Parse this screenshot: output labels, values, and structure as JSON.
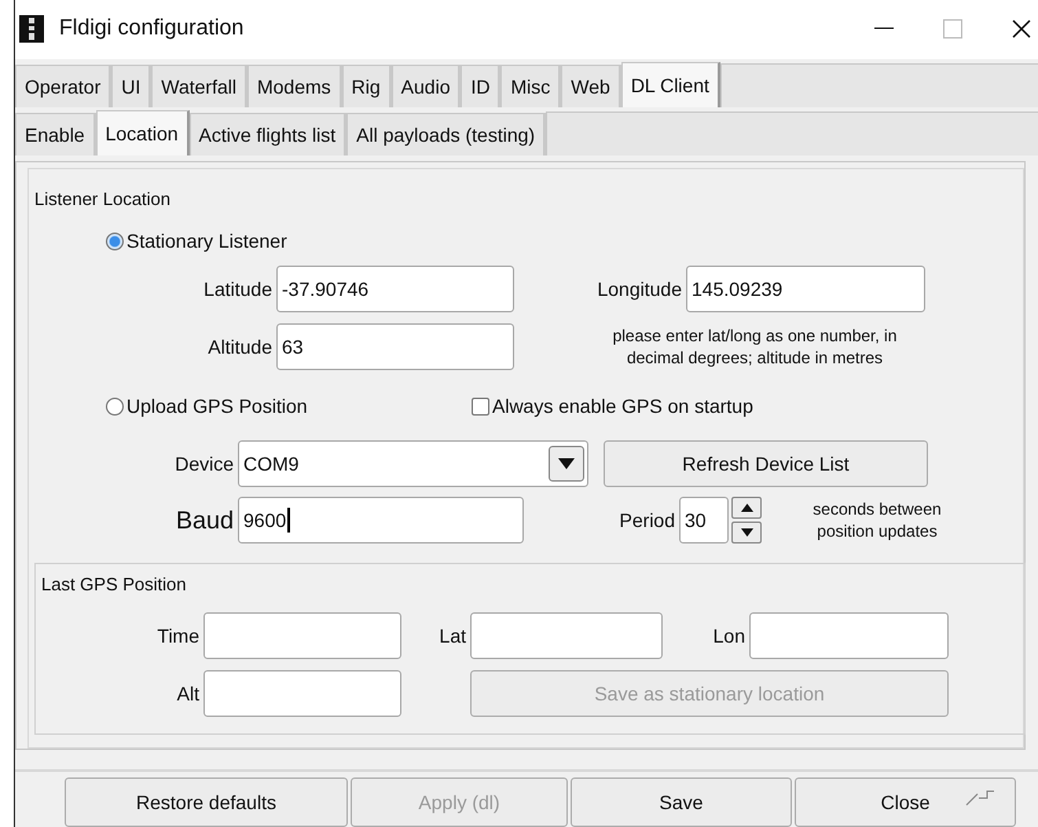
{
  "window": {
    "title": "Fldigi configuration"
  },
  "tabs": [
    {
      "label": "Operator",
      "selected": false
    },
    {
      "label": "UI",
      "selected": false
    },
    {
      "label": "Waterfall",
      "selected": false
    },
    {
      "label": "Modems",
      "selected": false
    },
    {
      "label": "Rig",
      "selected": false
    },
    {
      "label": "Audio",
      "selected": false
    },
    {
      "label": "ID",
      "selected": false
    },
    {
      "label": "Misc",
      "selected": false
    },
    {
      "label": "Web",
      "selected": false
    },
    {
      "label": "DL Client",
      "selected": true
    }
  ],
  "subtabs": [
    {
      "label": "Enable",
      "selected": false
    },
    {
      "label": "Location",
      "selected": true
    },
    {
      "label": "Active flights list",
      "selected": false
    },
    {
      "label": "All payloads (testing)",
      "selected": false
    }
  ],
  "listener_location": {
    "title": "Listener Location",
    "stationary": {
      "label": "Stationary Listener",
      "selected": true
    },
    "latitude": {
      "label": "Latitude",
      "value": "-37.90746"
    },
    "longitude": {
      "label": "Longitude",
      "value": "145.09239"
    },
    "altitude": {
      "label": "Altitude",
      "value": "63"
    },
    "hint": "please enter lat/long as one number, in decimal degrees; altitude in metres",
    "upload_gps": {
      "label": "Upload GPS Position",
      "selected": false
    },
    "always_enable_gps": {
      "label": "Always enable GPS on startup",
      "checked": false
    },
    "device": {
      "label": "Device",
      "value": "COM9"
    },
    "refresh_button": {
      "label": "Refresh Device List"
    },
    "baud": {
      "label": "Baud",
      "value": "9600",
      "focused": true
    },
    "period": {
      "label": "Period",
      "value": "30"
    },
    "period_hint": "seconds between position updates"
  },
  "last_gps_position": {
    "title": "Last GPS Position",
    "time": {
      "label": "Time"
    },
    "lat": {
      "label": "Lat"
    },
    "lon": {
      "label": "Lon"
    },
    "alt": {
      "label": "Alt"
    },
    "save_button": {
      "label": "Save as stationary location",
      "disabled": true
    }
  },
  "buttons": [
    {
      "label": "Restore defaults",
      "disabled": false
    },
    {
      "label": "Apply (dl)",
      "disabled": true
    },
    {
      "label": "Save",
      "disabled": false
    },
    {
      "label": "Close",
      "disabled": false
    }
  ]
}
